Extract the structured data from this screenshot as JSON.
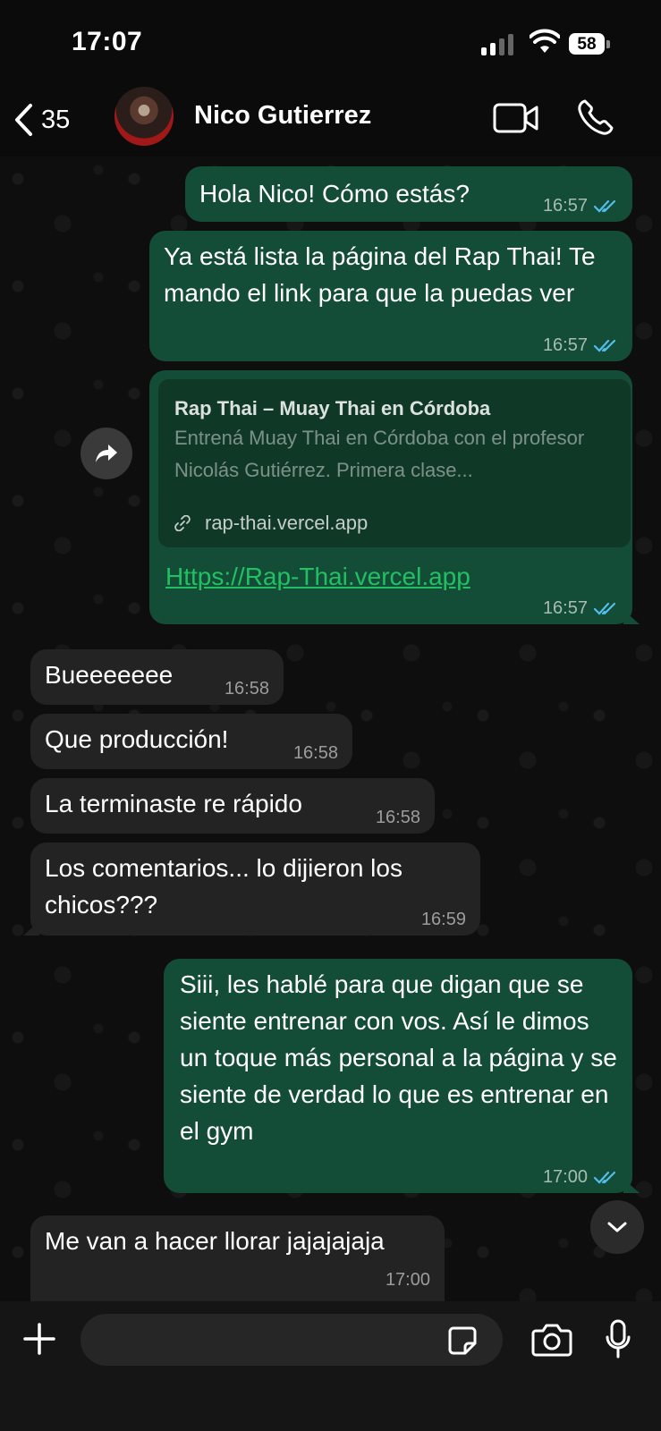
{
  "status_bar": {
    "time": "17:07",
    "battery": "58"
  },
  "header": {
    "back_count": "35",
    "contact_name": "Nico Gutierrez"
  },
  "messages": [
    {
      "direction": "out",
      "text": "Hola Nico! Cómo estás?",
      "time": "16:57",
      "read": true
    },
    {
      "direction": "out",
      "text": "Ya está lista la página del Rap Thai! Te mando el link para que la puedas ver",
      "time": "16:57",
      "read": true
    },
    {
      "direction": "out",
      "link_preview": {
        "title": "Rap Thai – Muay Thai en Córdoba",
        "description": "Entrená Muay Thai en Córdoba con el profesor Nicolás Gutiérrez. Primera clase...",
        "domain": "rap-thai.vercel.app"
      },
      "link": "Https://Rap-Thai.vercel.app",
      "time": "16:57",
      "read": true
    },
    {
      "direction": "in",
      "text": "Bueeeeeee",
      "time": "16:58"
    },
    {
      "direction": "in",
      "text": "Que producción!",
      "time": "16:58"
    },
    {
      "direction": "in",
      "text": "La terminaste re rápido",
      "time": "16:58"
    },
    {
      "direction": "in",
      "text": "Los comentarios... lo dijieron los chicos???",
      "time": "16:59"
    },
    {
      "direction": "out",
      "text": "Siii, les hablé para que digan que se siente entrenar con vos. Así le dimos un toque más personal a la página y se siente de verdad lo que es entrenar en el gym",
      "time": "17:00",
      "read": true
    },
    {
      "direction": "in",
      "text": "Me van a hacer llorar jajajajaja",
      "time": "17:00"
    }
  ],
  "icons": {
    "back": "chevron-left-icon",
    "video": "video-camera-icon",
    "call": "phone-icon",
    "forward": "forward-icon",
    "scroll": "chevron-down-icon",
    "attach": "plus-icon",
    "sticker": "sticker-icon",
    "camera": "camera-icon",
    "mic": "microphone-icon",
    "read_ticks": "double-check-icon"
  },
  "colors": {
    "outgoing_bubble": "#144d37",
    "incoming_bubble": "#232323",
    "link": "#21c063",
    "read_ticks": "#53bdeb"
  }
}
